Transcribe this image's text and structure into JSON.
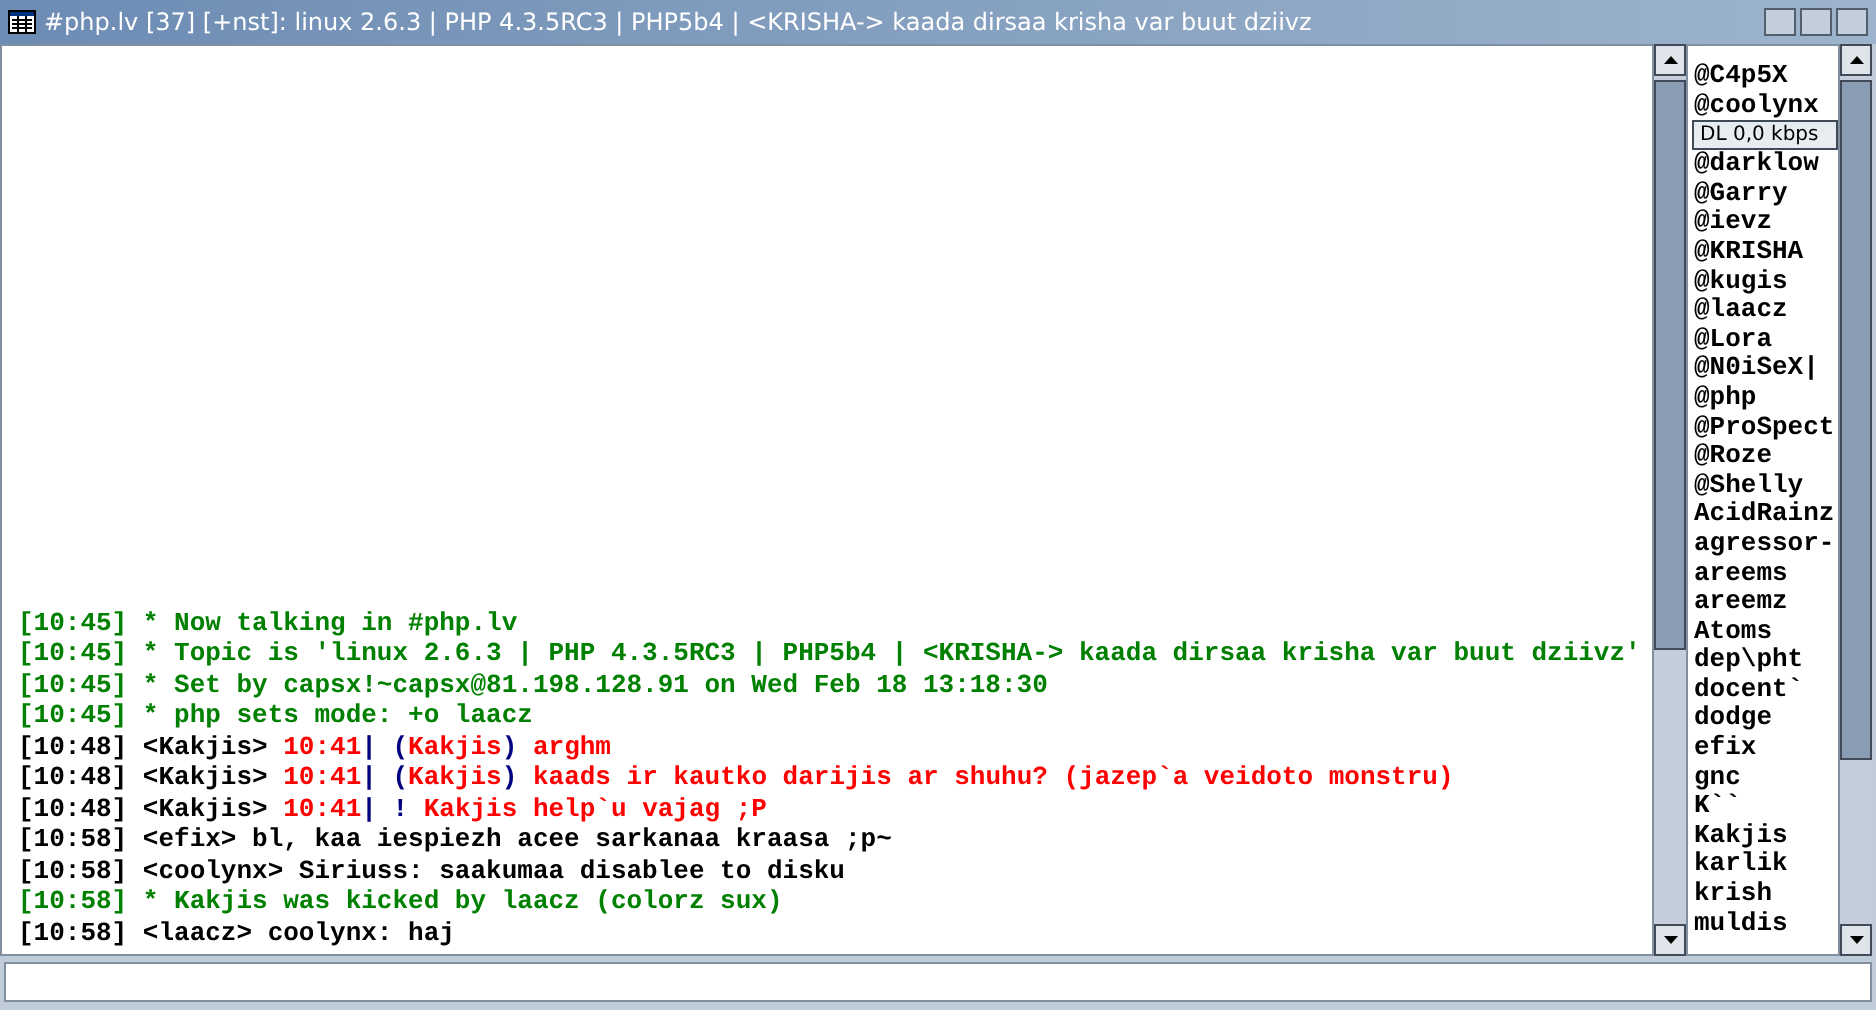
{
  "window": {
    "title": "#php.lv [37] [+nst]: linux 2.6.3 | PHP 4.3.5RC3 | PHP5b4 | <KRISHA-> kaada dirsaa krisha var buut dziivz"
  },
  "chat": [
    {
      "parts": [
        {
          "text": "[10:45] * Now talking in #php.lv",
          "color": "#008000"
        }
      ]
    },
    {
      "parts": [
        {
          "text": "[10:45] * Topic is 'linux 2.6.3 | PHP 4.3.5RC3 | PHP5b4 | <KRISHA-> kaada dirsaa krisha var buut dziivz'",
          "color": "#008000"
        }
      ]
    },
    {
      "parts": [
        {
          "text": "[10:45] * Set by capsx!~capsx@81.198.128.91 on Wed Feb 18 13:18:30",
          "color": "#008000"
        }
      ]
    },
    {
      "parts": [
        {
          "text": "[10:45] * php sets mode: +o laacz",
          "color": "#008000"
        }
      ]
    },
    {
      "parts": [
        {
          "text": "[10:48] <Kakjis> ",
          "color": "#000000"
        },
        {
          "text": "10:41",
          "color": "#ff0000"
        },
        {
          "text": "| (",
          "color": "#000080"
        },
        {
          "text": "Kakjis",
          "color": "#ff0000"
        },
        {
          "text": ")",
          "color": "#000080"
        },
        {
          "text": " arghm",
          "color": "#ff0000"
        }
      ]
    },
    {
      "parts": [
        {
          "text": "[10:48] <Kakjis> ",
          "color": "#000000"
        },
        {
          "text": "10:41",
          "color": "#ff0000"
        },
        {
          "text": "| (",
          "color": "#000080"
        },
        {
          "text": "Kakjis",
          "color": "#ff0000"
        },
        {
          "text": ")",
          "color": "#000080"
        },
        {
          "text": " kaads ir kautko darijis ar shuhu? (jazep`a veidoto monstru)",
          "color": "#ff0000"
        }
      ]
    },
    {
      "parts": [
        {
          "text": "[10:48] <Kakjis> ",
          "color": "#000000"
        },
        {
          "text": "10:41",
          "color": "#ff0000"
        },
        {
          "text": "| !",
          "color": "#000080"
        },
        {
          "text": " Kakjis help`u vajag ;P",
          "color": "#ff0000"
        }
      ]
    },
    {
      "parts": [
        {
          "text": "[10:58] <efix> bl, kaa iespiezh acee sarkanaa kraasa ;p~",
          "color": "#000000"
        }
      ]
    },
    {
      "parts": [
        {
          "text": "[10:58] <coolynx> Siriuss: saakumaa disablee to disku",
          "color": "#000000"
        }
      ]
    },
    {
      "parts": [
        {
          "text": "[10:58] * Kakjis was kicked by laacz (colorz sux)",
          "color": "#008000"
        }
      ]
    },
    {
      "parts": [
        {
          "text": "[10:58] <laacz> coolynx: haj",
          "color": "#000000"
        }
      ]
    }
  ],
  "nicklist": [
    "@C4p5X",
    "@coolynx",
    "@darklow",
    "@Garry",
    "@ievz",
    "@KRISHA",
    "@kugis",
    "@laacz",
    "@Lora",
    "@N0iSeX|",
    "@php",
    "@ProSpect",
    "@Roze",
    "@Shelly",
    "AcidRainz",
    "agressor-",
    "areems",
    "areemz",
    "Atoms",
    "dep\\pht",
    "docent`",
    "dodge",
    "efix",
    "gnc",
    "K``",
    "Kakjis",
    "karlik",
    "krish",
    "muldis"
  ],
  "bandwidth_widget": {
    "reading": "DL 0,0 kbps"
  }
}
